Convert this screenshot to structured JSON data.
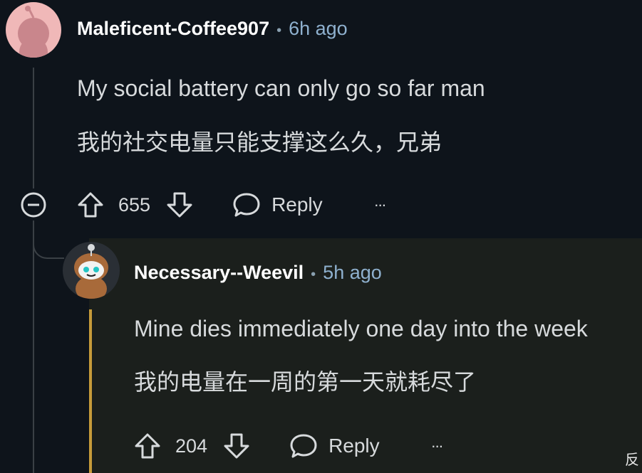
{
  "comment": {
    "username": "Maleficent-Coffee907",
    "time": "6h ago",
    "text_en": "My social battery can only go so far man",
    "text_zh": "我的社交电量只能支撑这么久，兄弟",
    "votes": "655",
    "reply_label": "Reply",
    "more_label": "···"
  },
  "reply": {
    "username": "Necessary--Weevil",
    "time": "5h ago",
    "text_en": "Mine dies immediately one day into the week",
    "text_zh": "我的电量在一周的第一天就耗尽了",
    "votes": "204",
    "reply_label": "Reply",
    "more_label": "···"
  },
  "separator": "•",
  "watermark": "反",
  "colors": {
    "background": "#0e141b",
    "reply_background": "#1b1f1c",
    "highlight": "#c69b3a",
    "time": "#8fb1cf"
  }
}
